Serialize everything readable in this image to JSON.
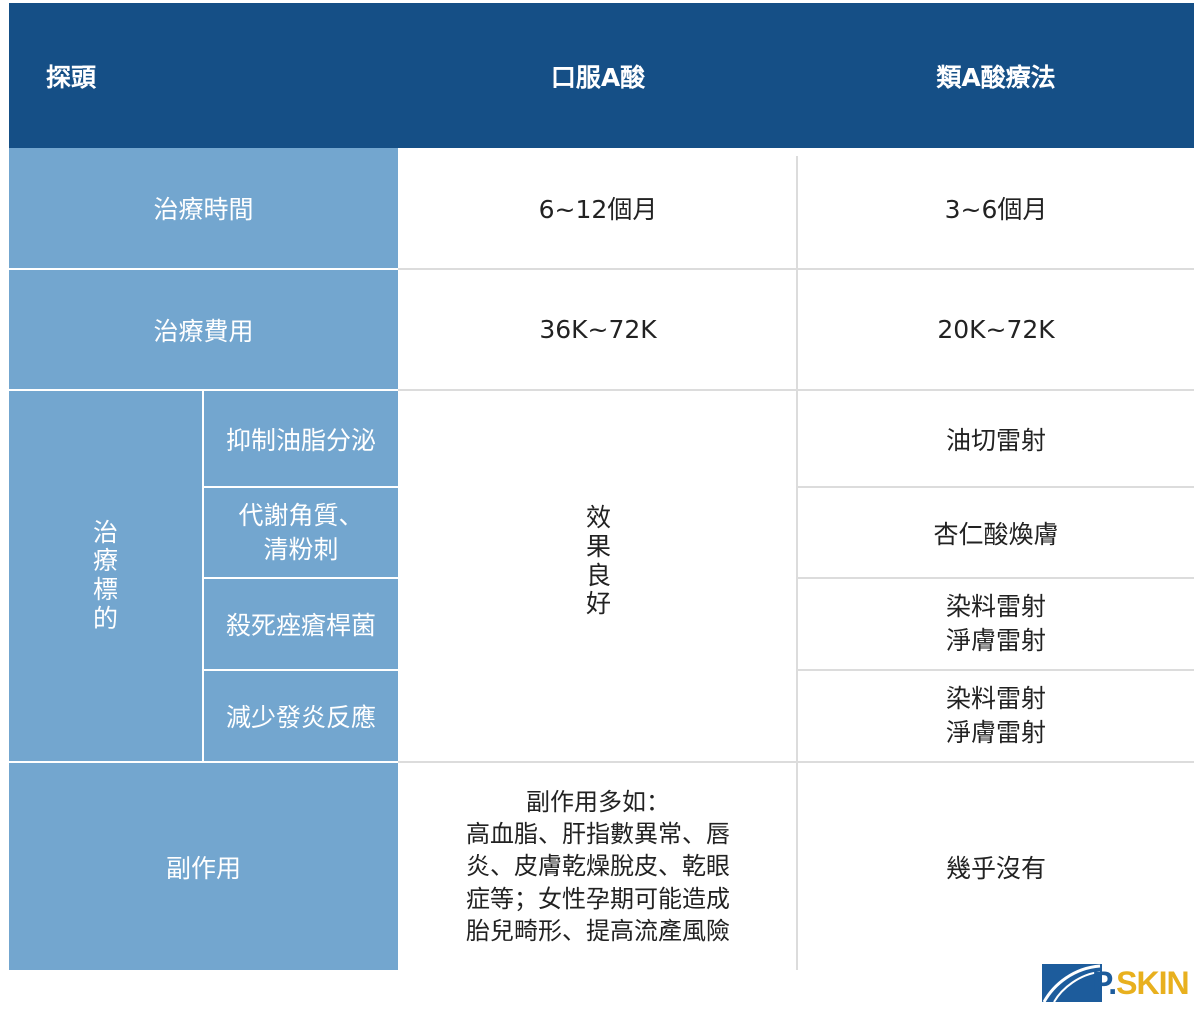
{
  "header": {
    "col1": "探頭",
    "col2": "口服A酸",
    "col3": "類A酸療法"
  },
  "rows": {
    "time": {
      "label": "治療時間",
      "oral": "6~12個月",
      "topical": "3~6個月"
    },
    "cost": {
      "label": "治療費用",
      "oral": "36K~72K",
      "topical": "20K~72K"
    },
    "target": {
      "label": "治療標的",
      "oral": "效果良好",
      "sub1": {
        "label": "抑制油脂分泌",
        "topical": "油切雷射"
      },
      "sub2": {
        "label_l1": "代謝角質、",
        "label_l2": "清粉刺",
        "topical": "杏仁酸煥膚"
      },
      "sub3": {
        "label": "殺死痤瘡桿菌",
        "topical_l1": "染料雷射",
        "topical_l2": "淨膚雷射"
      },
      "sub4": {
        "label": "減少發炎反應",
        "topical_l1": "染料雷射",
        "topical_l2": "淨膚雷射"
      }
    },
    "side": {
      "label": "副作用",
      "oral_lines": [
        "副作用多如：",
        "高血脂、肝指數異常、唇",
        "炎、皮膚乾燥脫皮、乾眼",
        "症等；女性孕期可能造成",
        "胎兒畸形、提高流產風險"
      ],
      "topical": "幾乎沒有"
    }
  },
  "logo": {
    "text": "P.SKIN"
  },
  "colors": {
    "header": "#154f86",
    "side": "#73a6cf",
    "logo_blue": "#1d5c9c",
    "logo_gold": "#e8b01e"
  }
}
